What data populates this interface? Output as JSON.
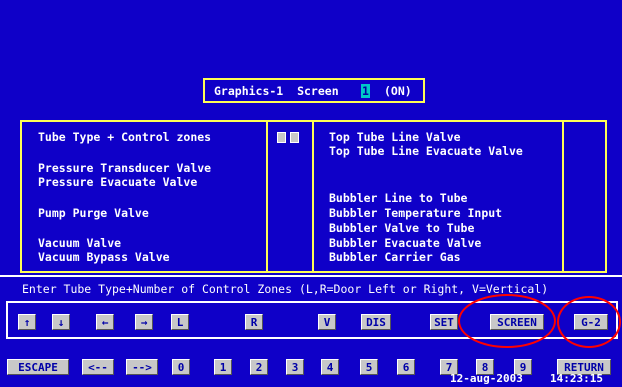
{
  "title": {
    "prefix": "Graphics-1  Screen",
    "screen_number": "1",
    "state": "(ON)"
  },
  "left_panel": {
    "items": [
      "Tube Type + Control zones",
      "Pressure Transducer Valve",
      "Pressure Evacuate Valve",
      "Pump Purge Valve",
      "Vacuum Valve",
      "Vacuum Bypass Valve"
    ]
  },
  "right_panel": {
    "items": [
      "Top Tube Line Valve",
      "Top Tube Line Evacuate Valve",
      "Bubbler Line to Tube",
      "Bubbler Temperature Input",
      "Bubbler Valve to Tube",
      "Bubbler Evacuate Valve",
      "Bubbler Carrier Gas"
    ]
  },
  "prompt": "Enter Tube Type+Number of Control Zones (L,R=Door Left or Right, V=Vertical)",
  "function_keys": {
    "up": "↑",
    "down": "↓",
    "left": "←",
    "right": "→",
    "l": "L",
    "r": "R",
    "v": "V",
    "dis": "DIS",
    "set": "SET",
    "screen": "SCREEN",
    "g2": "G-2"
  },
  "bottom_keys": {
    "escape": "ESCAPE",
    "back": "<--",
    "forward": "-->",
    "digits": [
      "0",
      "1",
      "2",
      "3",
      "4",
      "5",
      "6",
      "7",
      "8",
      "9"
    ],
    "return": "RETURN"
  },
  "status": {
    "date": "12-aug-2003",
    "time": "14:23:15"
  },
  "colors": {
    "background": "#0f00c8",
    "border_yellow": "#ffff55",
    "button_gray": "#c8c8c8",
    "annotation_red": "#ff0000"
  }
}
